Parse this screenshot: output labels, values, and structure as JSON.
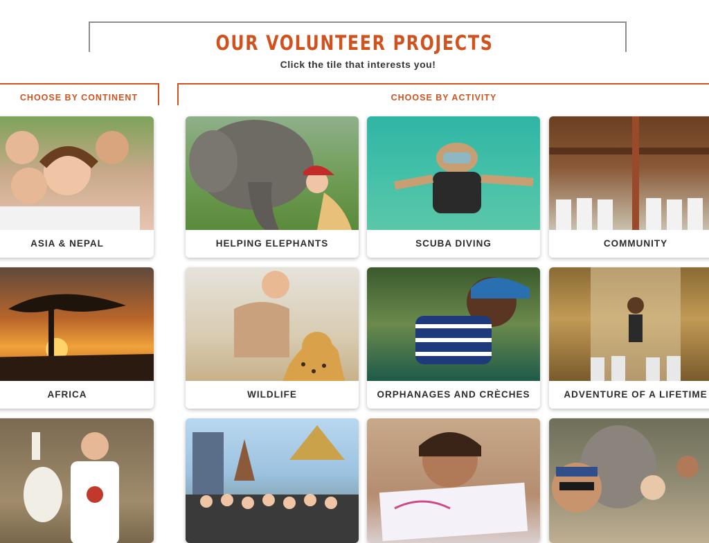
{
  "page": {
    "title": "OUR VOLUNTEER PROJECTS",
    "subtitle": "Click the tile that interests you!"
  },
  "sections": {
    "continent": "CHOOSE BY CONTINENT",
    "activity": "CHOOSE BY ACTIVITY"
  },
  "continent_tiles": [
    {
      "label": "ASIA & NEPAL",
      "image": "smiling-volunteer-with-children-photo"
    },
    {
      "label": "AFRICA",
      "image": "acacia-tree-sunset-photo"
    },
    {
      "label": "",
      "image": "volunteer-with-llama-photo"
    }
  ],
  "activity_tiles": [
    {
      "label": "HELPING ELEPHANTS",
      "image": "volunteer-kissing-elephant-photo"
    },
    {
      "label": "SCUBA DIVING",
      "image": "scuba-diver-thumbs-up-photo"
    },
    {
      "label": "COMMUNITY",
      "image": "volunteer-group-wooden-structure-photo"
    },
    {
      "label": "WILDLIFE",
      "image": "volunteer-with-cheetah-photo"
    },
    {
      "label": "ORPHANAGES AND CRÈCHES",
      "image": "smiling-child-striped-sweater-photo"
    },
    {
      "label": "ADVENTURE OF A LIFETIME",
      "image": "waterfall-group-photo"
    },
    {
      "label": "",
      "image": "group-at-temple-photo"
    },
    {
      "label": "",
      "image": "child-holding-drawing-photo"
    },
    {
      "label": "",
      "image": "selfie-with-elephant-photo"
    }
  ],
  "colors": {
    "accent": "#d0531f",
    "header_border": "#8c8c8c",
    "label_text": "#2b2b2b"
  }
}
